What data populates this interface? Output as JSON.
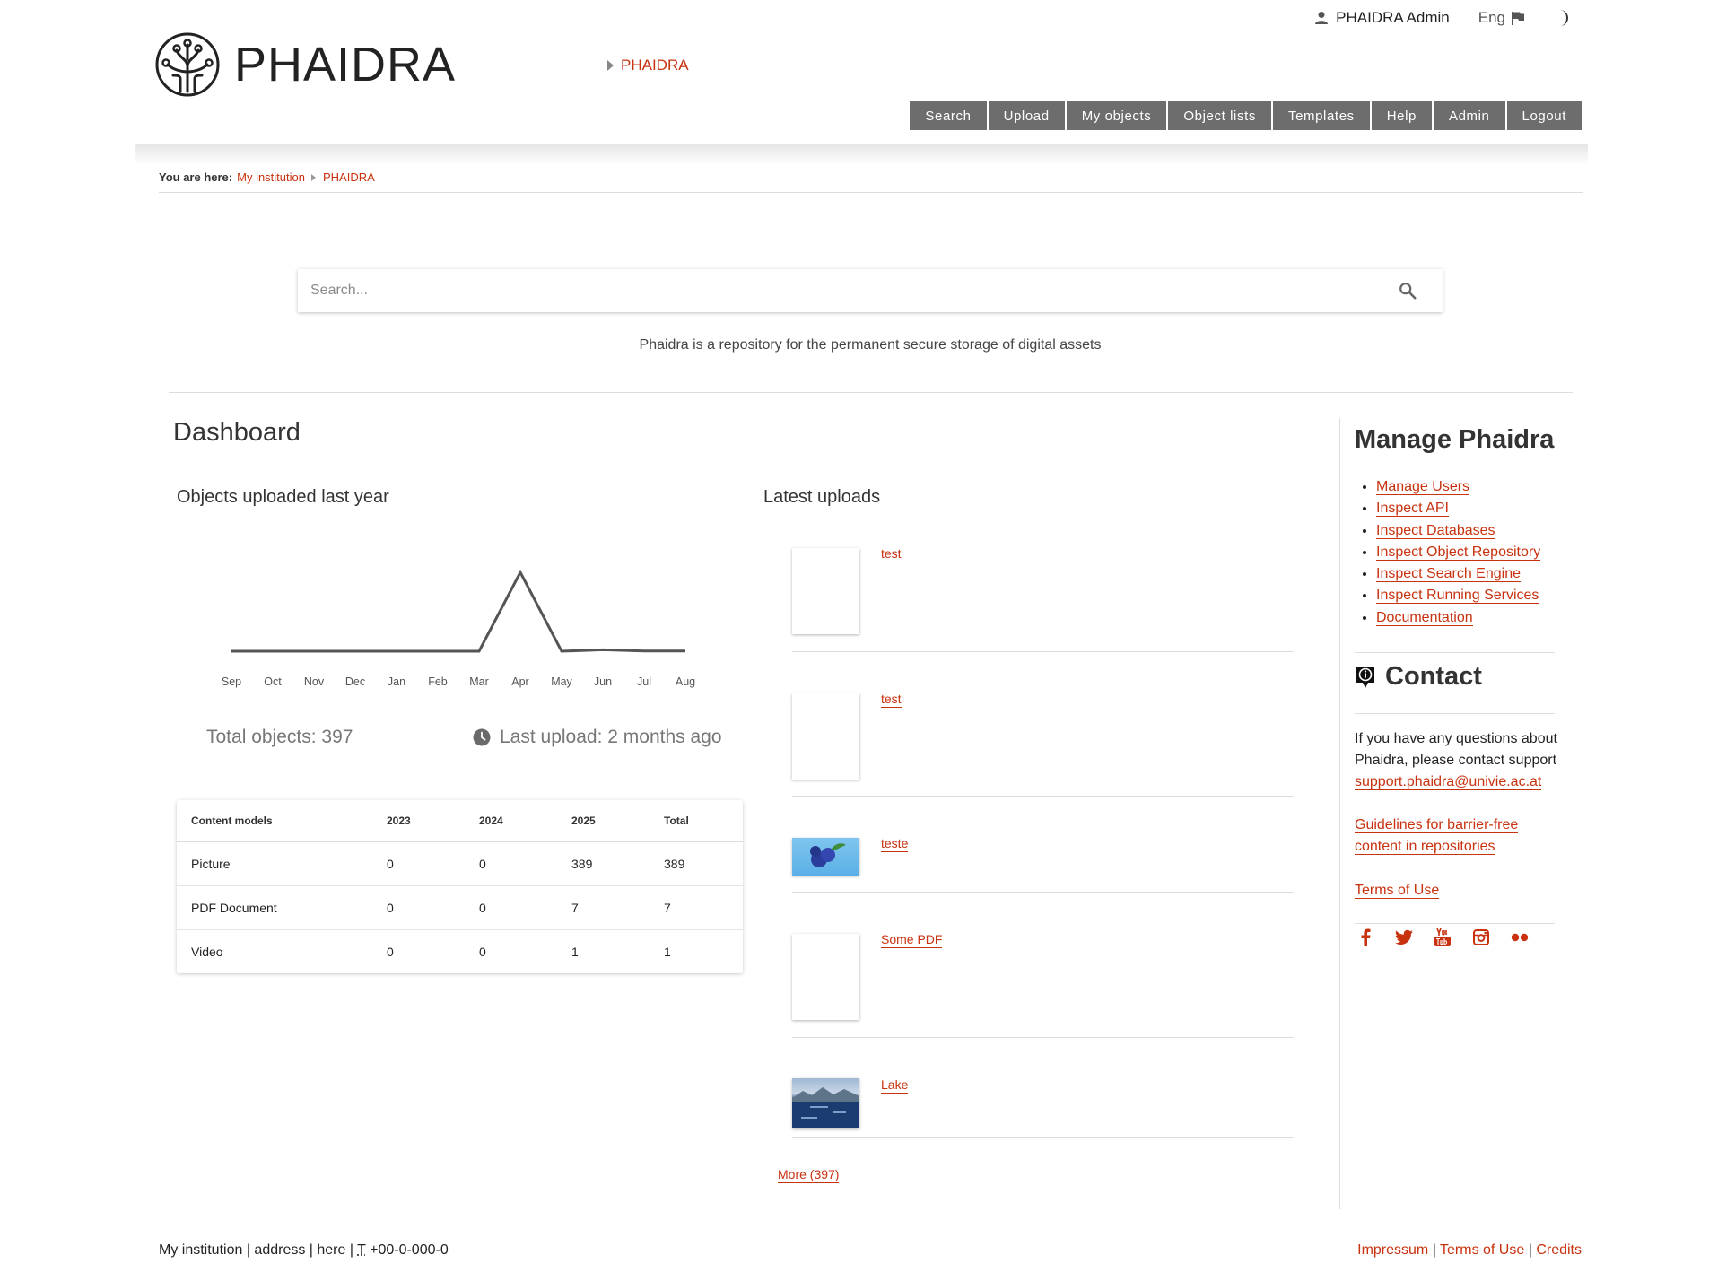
{
  "header": {
    "logo_text": "PHAIDRA",
    "crumb": "PHAIDRA",
    "user_name": "PHAIDRA Admin",
    "language": "Eng",
    "nav": [
      "Search",
      "Upload",
      "My objects",
      "Object lists",
      "Templates",
      "Help",
      "Admin",
      "Logout"
    ]
  },
  "breadcrumb": {
    "label": "You are here:",
    "items": [
      "My institution",
      "PHAIDRA"
    ]
  },
  "search": {
    "placeholder": "Search...",
    "tagline": "Phaidra is a repository for the permanent secure storage of digital assets"
  },
  "dashboard": {
    "title": "Dashboard",
    "chart_title": "Objects uploaded last year",
    "total_objects": "Total objects: 397",
    "last_upload": "Last upload: 2 months ago",
    "table": {
      "headers": [
        "Content models",
        "2023",
        "2024",
        "2025",
        "Total"
      ],
      "rows": [
        [
          "Picture",
          "0",
          "0",
          "389",
          "389"
        ],
        [
          "PDF Document",
          "0",
          "0",
          "7",
          "7"
        ],
        [
          "Video",
          "0",
          "0",
          "1",
          "1"
        ]
      ]
    }
  },
  "chart_data": {
    "type": "line",
    "categories": [
      "Sep",
      "Oct",
      "Nov",
      "Dec",
      "Jan",
      "Feb",
      "Mar",
      "Apr",
      "May",
      "Jun",
      "Jul",
      "Aug"
    ],
    "values": [
      0,
      0,
      0,
      0,
      0,
      0,
      0,
      389,
      0,
      7,
      1,
      1
    ],
    "title": "Objects uploaded last year",
    "color": "#555555",
    "grid": false
  },
  "latest": {
    "title": "Latest uploads",
    "items": [
      {
        "title": "test",
        "thumb": "blank"
      },
      {
        "title": "test",
        "thumb": "blank"
      },
      {
        "title": "teste",
        "thumb": "blueberry"
      },
      {
        "title": "Some PDF",
        "thumb": "blank"
      },
      {
        "title": "Lake",
        "thumb": "lake"
      }
    ],
    "more": "More (397)"
  },
  "manage": {
    "title": "Manage Phaidra",
    "links": [
      "Manage Users",
      "Inspect API",
      "Inspect Databases",
      "Inspect Object Repository",
      "Inspect Search Engine",
      "Inspect Running Services",
      "Documentation"
    ]
  },
  "contact": {
    "title": "Contact",
    "text": "If you have any questions about Phaidra, please contact support",
    "email": "support.phaidra@univie.ac.at",
    "guidelines": "Guidelines for barrier-free content in repositories",
    "terms": "Terms of Use",
    "social": [
      "facebook-icon",
      "twitter-icon",
      "youtube-icon",
      "instagram-icon",
      "flickr-icon"
    ]
  },
  "footer": {
    "left_main": "My institution | address | here | ",
    "left_tel_abbr": "T",
    "left_tel": " +00-0-000-0",
    "links": [
      "Impressum",
      "Terms of Use",
      "Credits"
    ],
    "separator": " | "
  },
  "colors": {
    "accent": "#c8320f",
    "nav_bg": "#6d6d6d",
    "line": "#555555"
  }
}
